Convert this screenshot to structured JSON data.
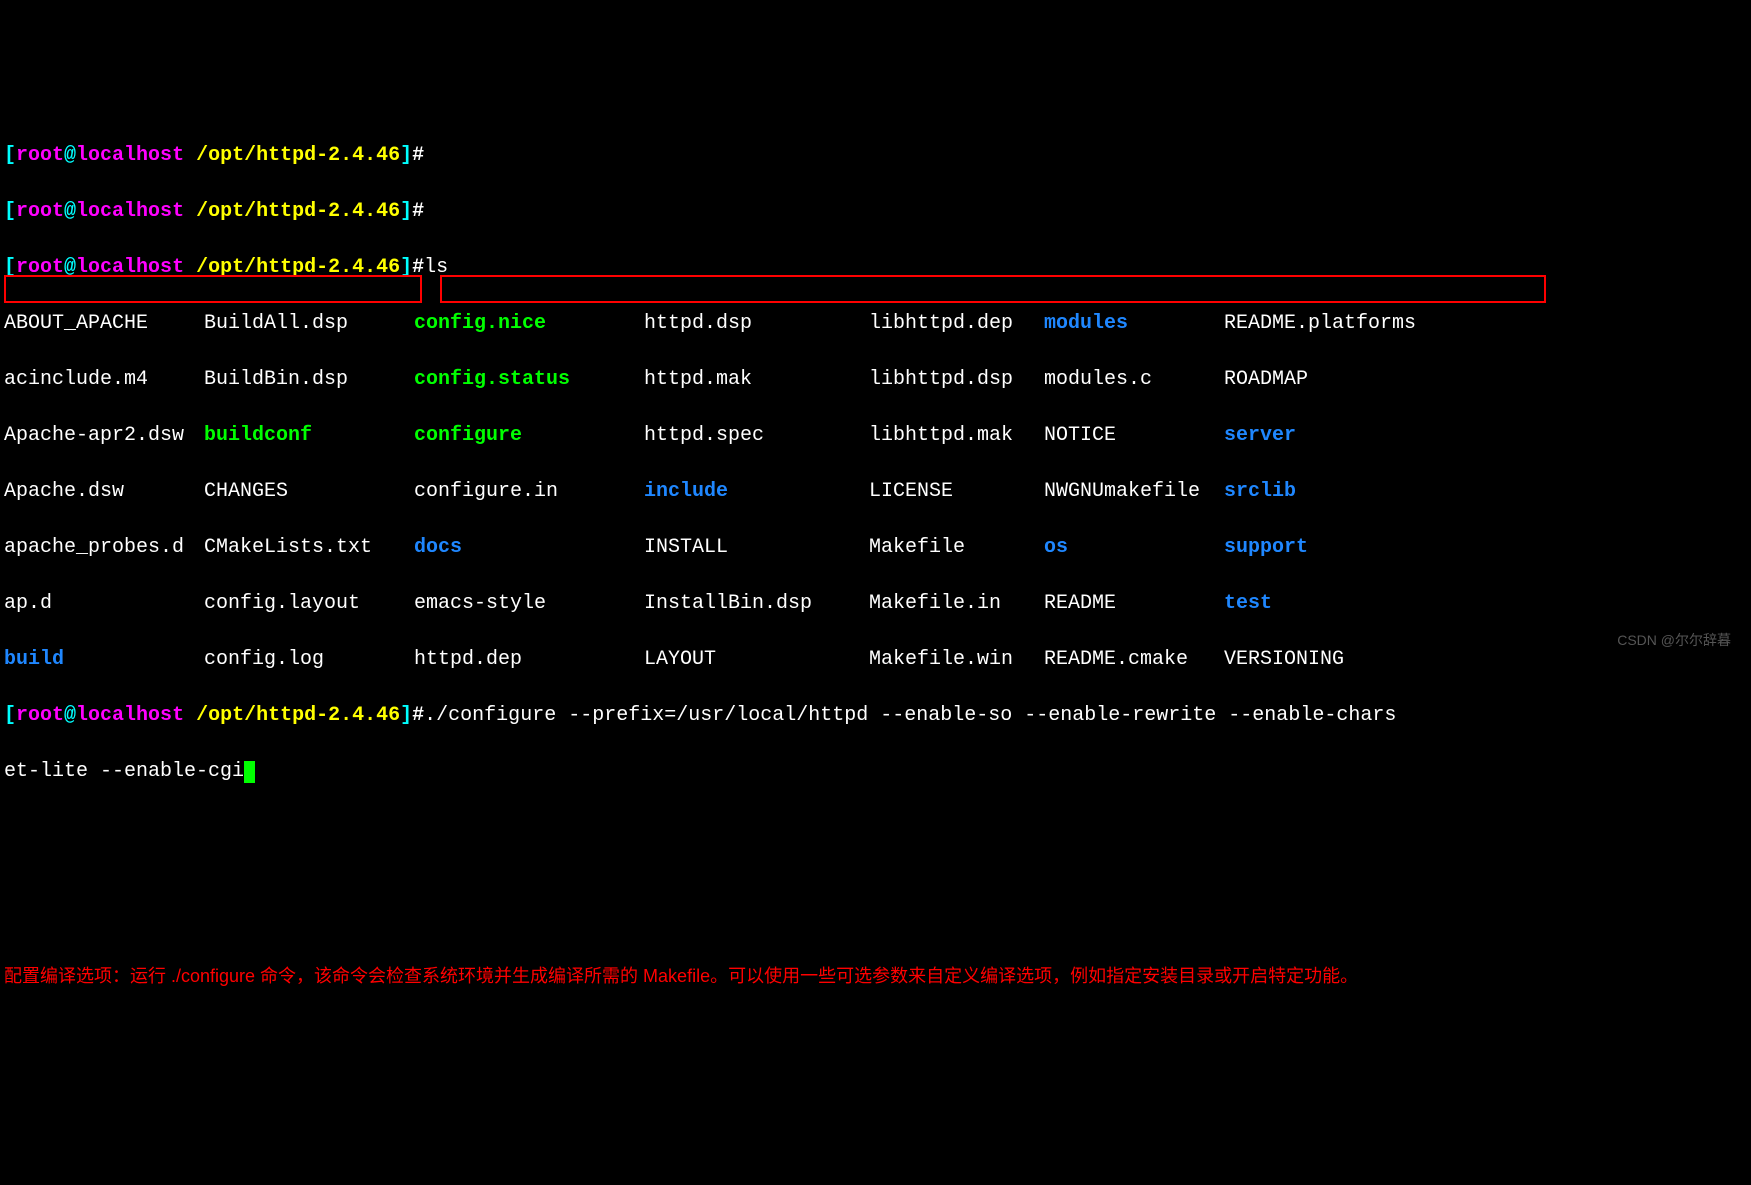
{
  "prompt": {
    "open": "[",
    "user": "root",
    "at": "@",
    "host": "localhost",
    "space": " ",
    "path": "/opt/httpd-2.4.46",
    "close": "]",
    "hash": "#"
  },
  "cmd_ls": "ls",
  "ls": {
    "r1": {
      "c1": "ABOUT_APACHE",
      "c2": "BuildAll.dsp",
      "c3": "config.nice",
      "c4": "httpd.dsp",
      "c5": "libhttpd.dep",
      "c6": "modules",
      "c7": "README.platforms"
    },
    "r2": {
      "c1": "acinclude.m4",
      "c2": "BuildBin.dsp",
      "c3": "config.status",
      "c4": "httpd.mak",
      "c5": "libhttpd.dsp",
      "c6": "modules.c",
      "c7": "ROADMAP"
    },
    "r3": {
      "c1": "Apache-apr2.dsw",
      "c2": "buildconf",
      "c3": "configure",
      "c4": "httpd.spec",
      "c5": "libhttpd.mak",
      "c6": "NOTICE",
      "c7": "server"
    },
    "r4": {
      "c1": "Apache.dsw",
      "c2": "CHANGES",
      "c3": "configure.in",
      "c4": "include",
      "c5": "LICENSE",
      "c6": "NWGNUmakefile",
      "c7": "srclib"
    },
    "r5": {
      "c1": "apache_probes.d",
      "c2": "CMakeLists.txt",
      "c3": "docs",
      "c4": "INSTALL",
      "c5": "Makefile",
      "c6": "os",
      "c7": "support"
    },
    "r6": {
      "c1": "ap.d",
      "c2": "config.layout",
      "c3": "emacs-style",
      "c4": "InstallBin.dsp",
      "c5": "Makefile.in",
      "c6": "README",
      "c7": "test"
    },
    "r7": {
      "c1": "build",
      "c2": "config.log",
      "c3": "httpd.dep",
      "c4": "LAYOUT",
      "c5": "Makefile.win",
      "c6": "README.cmake",
      "c7": "VERSIONING"
    }
  },
  "configure_cmd_part1": "./configure --prefix=/usr/local/httpd --enable-so --enable-rewrite --enable-chars",
  "configure_cmd_part2": "et-lite --enable-cgi",
  "annotation": "配置编译选项：运行 ./configure 命令，该命令会检查系统环境并生成编译所需的 Makefile。可以使用一些可选参数来自定义编译选项，例如指定安装目录或开启特定功能。",
  "watermark": "CSDN @尔尔辞暮"
}
